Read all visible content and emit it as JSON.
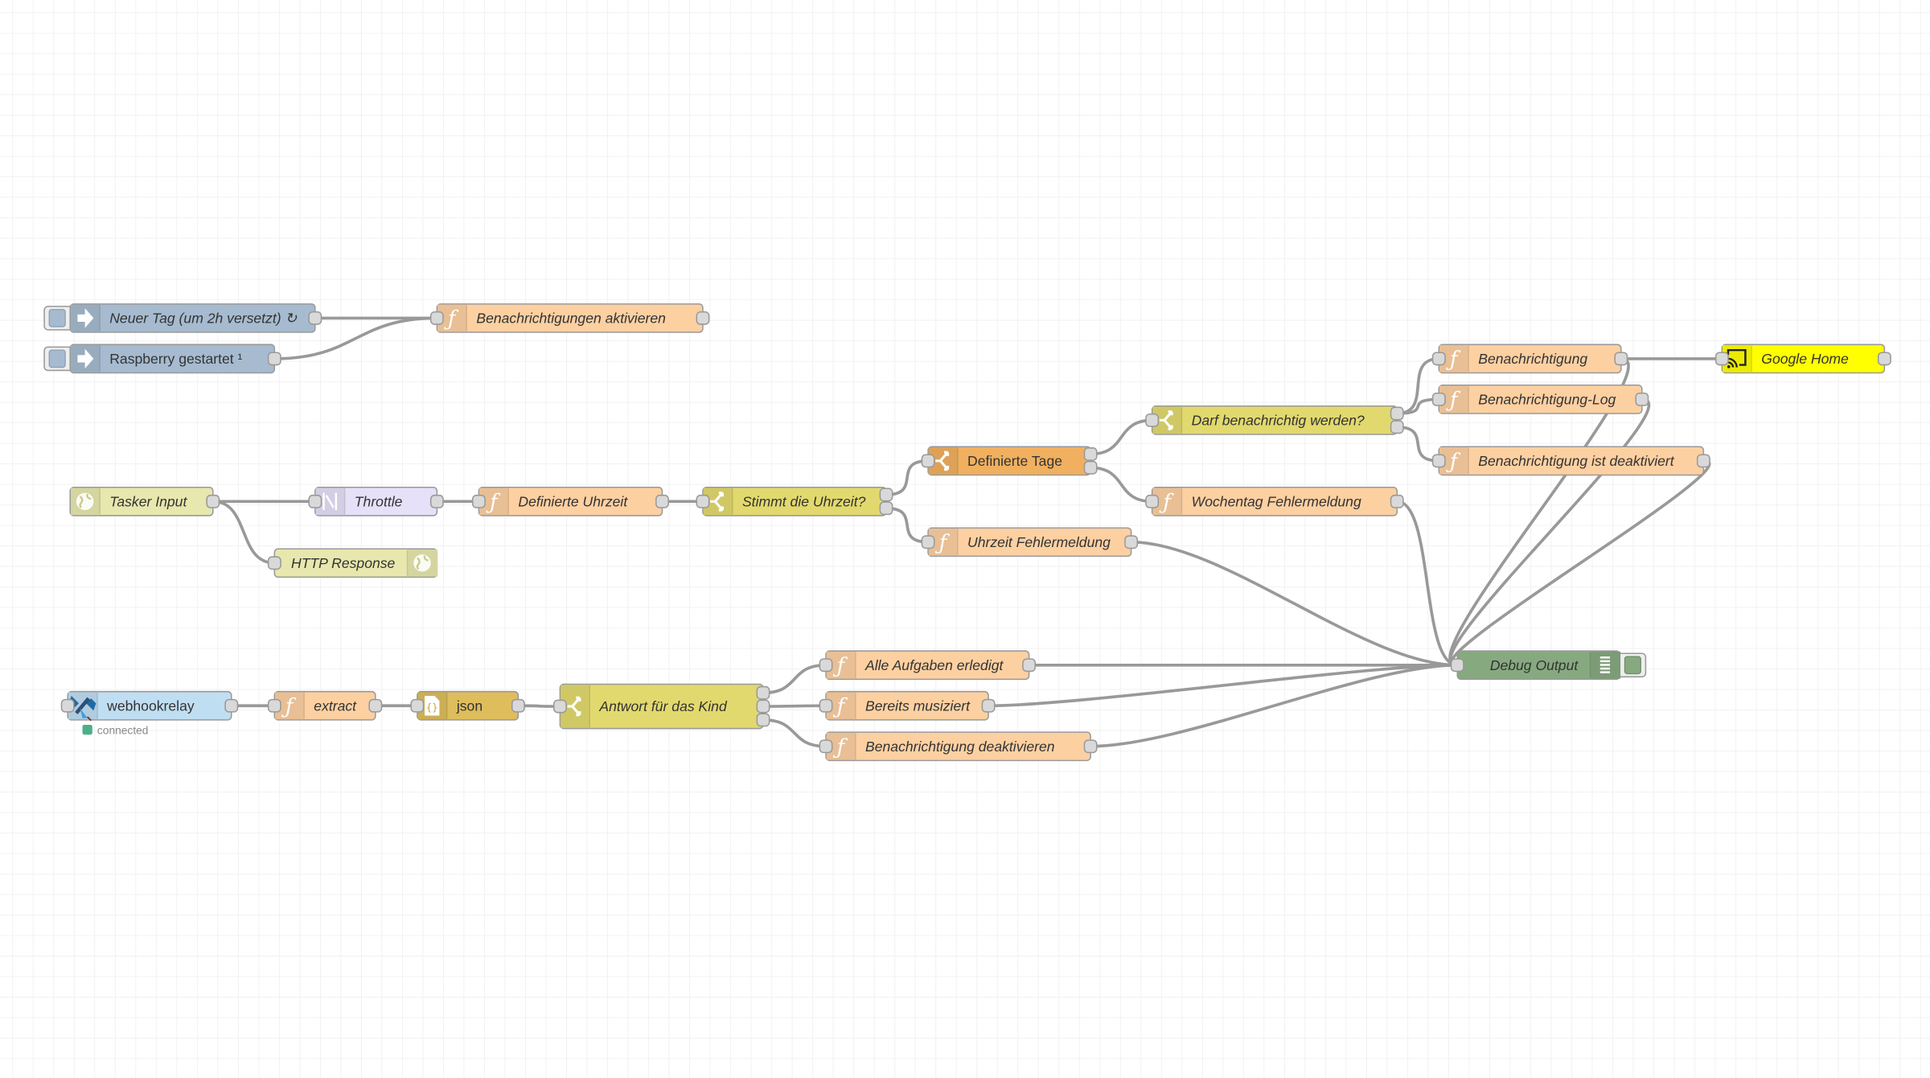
{
  "app": "Node-RED flow editor",
  "colors": {
    "inject": "#a6bbcf",
    "function": "#fdd0a2",
    "switch": "#e2d96e",
    "switch_orange": "#f0b060",
    "http": "#e7e7ae",
    "throttle": "#e6e0f8",
    "json": "#debd5c",
    "google_home": "#ffff00",
    "debug": "#87a980",
    "webhookrelay": "#c0def2",
    "status_connected": "#4caf88",
    "wire": "#999999"
  },
  "nodes": [
    {
      "id": "n_neuer_tag",
      "type": "inject",
      "label": "Neuer Tag (um 2h versetzt) ↻",
      "icon": "arrow-right-icon",
      "italic": true
    },
    {
      "id": "n_raspberry",
      "type": "inject",
      "label": "Raspberry gestartet ¹",
      "icon": "arrow-right-icon",
      "italic": false
    },
    {
      "id": "n_benachr_aktiv",
      "type": "function",
      "label": "Benachrichtigungen aktivieren",
      "icon": "function-icon",
      "italic": true
    },
    {
      "id": "n_tasker",
      "type": "http",
      "label": "Tasker Input",
      "icon": "globe-icon",
      "italic": true
    },
    {
      "id": "n_throttle",
      "type": "throttle",
      "label": "Throttle",
      "icon": "throttle-icon",
      "italic": true
    },
    {
      "id": "n_def_uhrzeit",
      "type": "function",
      "label": "Definierte Uhrzeit",
      "icon": "function-icon",
      "italic": true
    },
    {
      "id": "n_stimmt",
      "type": "switch",
      "label": "Stimmt die Uhrzeit?",
      "icon": "switch-icon",
      "italic": true
    },
    {
      "id": "n_http_resp",
      "type": "http",
      "label": "HTTP Response",
      "icon": "globe-icon",
      "italic": true
    },
    {
      "id": "n_def_tage",
      "type": "switch_orange",
      "label": "Definierte Tage",
      "icon": "switch-icon",
      "italic": false
    },
    {
      "id": "n_uhrzeit_fehler",
      "type": "function",
      "label": "Uhrzeit Fehlermeldung",
      "icon": "function-icon",
      "italic": true
    },
    {
      "id": "n_darf",
      "type": "switch",
      "label": "Darf benachrichtig werden?",
      "icon": "switch-icon",
      "italic": true
    },
    {
      "id": "n_wochentag",
      "type": "function",
      "label": "Wochentag Fehlermeldung",
      "icon": "function-icon",
      "italic": true
    },
    {
      "id": "n_benachr",
      "type": "function",
      "label": "Benachrichtigung",
      "icon": "function-icon",
      "italic": true
    },
    {
      "id": "n_benachr_log",
      "type": "function",
      "label": "Benachrichtigung-Log",
      "icon": "function-icon",
      "italic": true
    },
    {
      "id": "n_benachr_deakt_ist",
      "type": "function",
      "label": "Benachrichtigung ist deaktiviert",
      "icon": "function-icon",
      "italic": true
    },
    {
      "id": "n_google",
      "type": "google_home",
      "label": "Google Home",
      "icon": "cast-icon",
      "italic": true
    },
    {
      "id": "n_debug",
      "type": "debug",
      "label": "Debug Output",
      "icon": "debug-list-icon",
      "italic": true
    },
    {
      "id": "n_webhook",
      "type": "webhookrelay",
      "label": "webhookrelay",
      "icon": "satellite-icon",
      "italic": false,
      "status": "connected"
    },
    {
      "id": "n_extract",
      "type": "function",
      "label": "extract",
      "icon": "function-icon",
      "italic": true
    },
    {
      "id": "n_json",
      "type": "json",
      "label": "json",
      "icon": "json-icon",
      "italic": false
    },
    {
      "id": "n_antwort",
      "type": "switch",
      "label": "Antwort für das Kind",
      "icon": "switch-icon",
      "italic": true
    },
    {
      "id": "n_alle",
      "type": "function",
      "label": "Alle Aufgaben erledigt",
      "icon": "function-icon",
      "italic": true
    },
    {
      "id": "n_bereits",
      "type": "function",
      "label": "Bereits musiziert",
      "icon": "function-icon",
      "italic": true
    },
    {
      "id": "n_benachr_deakt",
      "type": "function",
      "label": "Benachrichtigung deaktivieren",
      "icon": "function-icon",
      "italic": true
    }
  ],
  "wires": [
    [
      "n_neuer_tag",
      0,
      "n_benachr_aktiv"
    ],
    [
      "n_raspberry",
      0,
      "n_benachr_aktiv"
    ],
    [
      "n_tasker",
      0,
      "n_throttle"
    ],
    [
      "n_tasker",
      0,
      "n_http_resp"
    ],
    [
      "n_throttle",
      0,
      "n_def_uhrzeit"
    ],
    [
      "n_def_uhrzeit",
      0,
      "n_stimmt"
    ],
    [
      "n_stimmt",
      0,
      "n_def_tage"
    ],
    [
      "n_stimmt",
      1,
      "n_uhrzeit_fehler"
    ],
    [
      "n_def_tage",
      0,
      "n_darf"
    ],
    [
      "n_def_tage",
      1,
      "n_wochentag"
    ],
    [
      "n_darf",
      0,
      "n_benachr"
    ],
    [
      "n_darf",
      0,
      "n_benachr_log"
    ],
    [
      "n_darf",
      1,
      "n_benachr_deakt_ist"
    ],
    [
      "n_benachr",
      0,
      "n_google"
    ],
    [
      "n_benachr",
      0,
      "n_debug"
    ],
    [
      "n_benachr_log",
      0,
      "n_debug"
    ],
    [
      "n_benachr_deakt_ist",
      0,
      "n_debug"
    ],
    [
      "n_wochentag",
      0,
      "n_debug"
    ],
    [
      "n_uhrzeit_fehler",
      0,
      "n_debug"
    ],
    [
      "n_webhook",
      0,
      "n_extract"
    ],
    [
      "n_extract",
      0,
      "n_json"
    ],
    [
      "n_json",
      0,
      "n_antwort"
    ],
    [
      "n_antwort",
      0,
      "n_alle"
    ],
    [
      "n_antwort",
      1,
      "n_bereits"
    ],
    [
      "n_antwort",
      2,
      "n_benachr_deakt"
    ],
    [
      "n_alle",
      0,
      "n_debug"
    ],
    [
      "n_bereits",
      0,
      "n_debug"
    ],
    [
      "n_benachr_deakt",
      0,
      "n_debug"
    ]
  ]
}
